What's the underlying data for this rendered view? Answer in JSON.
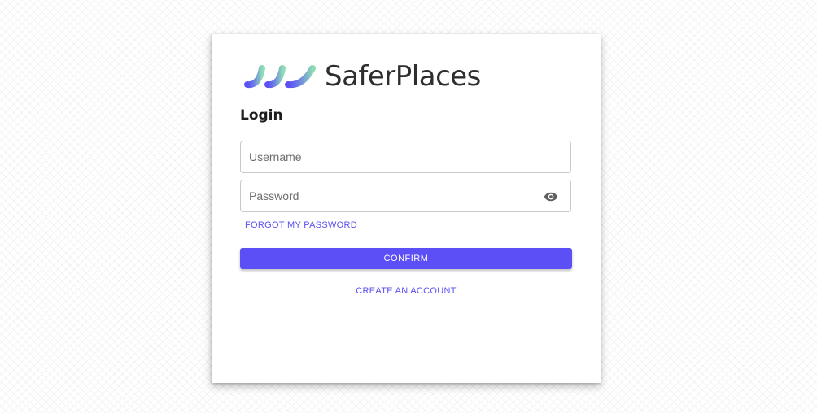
{
  "brand": {
    "name": "SaferPlaces",
    "logo_icon": "wave-logo-icon",
    "gradient_colors": [
      "#5b4ff5",
      "#8cdcb4"
    ],
    "text_color": "#2e2e2e"
  },
  "login": {
    "title": "Login",
    "username_placeholder": "Username",
    "password_placeholder": "Password",
    "password_toggle_icon": "eye-icon",
    "forgot_password": "FORGOT MY PASSWORD",
    "confirm": "CONFIRM",
    "create_account": "CREATE AN ACCOUNT"
  },
  "colors": {
    "accent": "#5b4ff5",
    "link": "#5a50f0",
    "background": "#ffffff"
  }
}
